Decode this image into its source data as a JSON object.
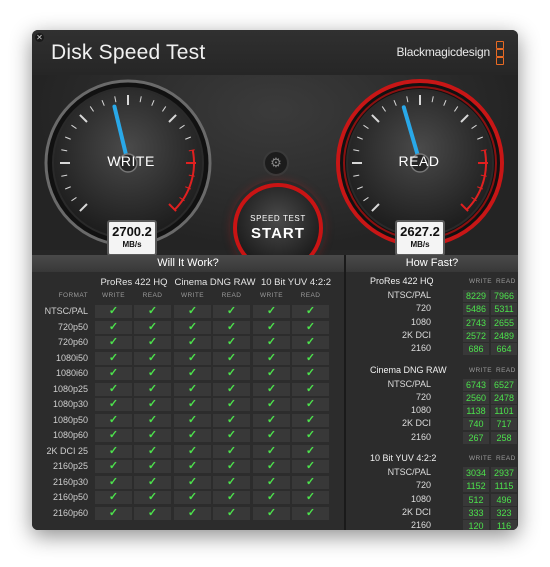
{
  "window": {
    "title": "Disk Speed Test",
    "brand": "Blackmagicdesign",
    "close_glyph": "✕"
  },
  "gauges": {
    "write": {
      "label": "WRITE",
      "value": "2700.2",
      "unit": "MB/s",
      "level": 0.45
    },
    "read": {
      "label": "READ",
      "value": "2627.2",
      "unit": "MB/s",
      "level": 0.44
    }
  },
  "start_button": {
    "line1": "SPEED TEST",
    "line2": "START"
  },
  "settings_icon": "gear-icon",
  "will_it_work": {
    "title": "Will It Work?",
    "format_label": "FORMAT",
    "groups": [
      {
        "name": "ProRes 422 HQ",
        "sub": [
          "WRITE",
          "READ"
        ]
      },
      {
        "name": "Cinema DNG RAW",
        "sub": [
          "WRITE",
          "READ"
        ]
      },
      {
        "name": "10 Bit YUV 4:2:2",
        "sub": [
          "WRITE",
          "READ"
        ]
      }
    ],
    "check_glyph": "✓",
    "rows": [
      "NTSC/PAL",
      "720p50",
      "720p60",
      "1080i50",
      "1080i60",
      "1080p25",
      "1080p30",
      "1080p50",
      "1080p60",
      "2K DCI 25",
      "2160p25",
      "2160p30",
      "2160p50",
      "2160p60"
    ]
  },
  "how_fast": {
    "title": "How Fast?",
    "sections": [
      {
        "name": "ProRes 422 HQ",
        "write_label": "WRITE",
        "read_label": "READ",
        "rows": [
          {
            "label": "NTSC/PAL",
            "write": "8229",
            "read": "7966"
          },
          {
            "label": "720",
            "write": "5486",
            "read": "5311"
          },
          {
            "label": "1080",
            "write": "2743",
            "read": "2655"
          },
          {
            "label": "2K DCI",
            "write": "2572",
            "read": "2489"
          },
          {
            "label": "2160",
            "write": "686",
            "read": "664"
          }
        ]
      },
      {
        "name": "Cinema DNG RAW",
        "write_label": "WRITE",
        "read_label": "READ",
        "rows": [
          {
            "label": "NTSC/PAL",
            "write": "6743",
            "read": "6527"
          },
          {
            "label": "720",
            "write": "2560",
            "read": "2478"
          },
          {
            "label": "1080",
            "write": "1138",
            "read": "1101"
          },
          {
            "label": "2K DCI",
            "write": "740",
            "read": "717"
          },
          {
            "label": "2160",
            "write": "267",
            "read": "258"
          }
        ]
      },
      {
        "name": "10 Bit YUV 4:2:2",
        "write_label": "WRITE",
        "read_label": "READ",
        "rows": [
          {
            "label": "NTSC/PAL",
            "write": "3034",
            "read": "2937"
          },
          {
            "label": "720",
            "write": "1152",
            "read": "1115"
          },
          {
            "label": "1080",
            "write": "512",
            "read": "496"
          },
          {
            "label": "2K DCI",
            "write": "333",
            "read": "323"
          },
          {
            "label": "2160",
            "write": "120",
            "read": "116"
          }
        ]
      }
    ]
  },
  "colors": {
    "accent_red": "#d01818",
    "needle_blue": "#29a8e8",
    "check_green": "#4ce24c",
    "brand_orange": "#e86a23"
  }
}
